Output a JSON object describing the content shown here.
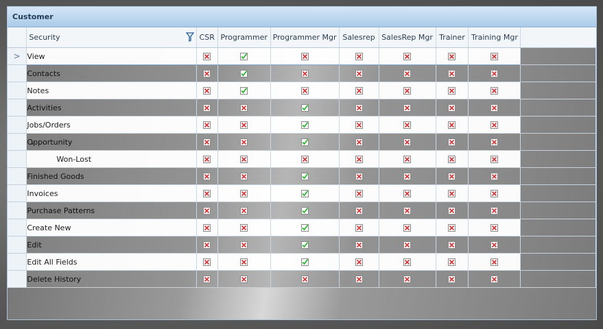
{
  "title": "Customer",
  "columns": [
    "Security",
    "CSR",
    "Programmer",
    "Programmer Mgr",
    "Salesrep",
    "SalesRep Mgr",
    "Trainer",
    "Training Mgr"
  ],
  "rows": [
    {
      "label": "View",
      "perms": [
        0,
        1,
        0,
        0,
        0,
        0,
        0
      ]
    },
    {
      "label": "Contacts",
      "perms": [
        0,
        1,
        0,
        0,
        0,
        0,
        0
      ]
    },
    {
      "label": "Notes",
      "perms": [
        0,
        1,
        0,
        0,
        0,
        0,
        0
      ]
    },
    {
      "label": "Activities",
      "perms": [
        0,
        0,
        1,
        0,
        0,
        0,
        0
      ]
    },
    {
      "label": "Jobs/Orders",
      "perms": [
        0,
        0,
        1,
        0,
        0,
        0,
        0
      ]
    },
    {
      "label": "Opportunity",
      "perms": [
        0,
        0,
        1,
        0,
        0,
        0,
        0
      ]
    },
    {
      "label": "Won-Lost",
      "perms": [
        0,
        0,
        0,
        0,
        0,
        0,
        0
      ]
    },
    {
      "label": "Finished Goods",
      "perms": [
        0,
        0,
        1,
        0,
        0,
        0,
        0
      ]
    },
    {
      "label": "Invoices",
      "perms": [
        0,
        0,
        1,
        0,
        0,
        0,
        0
      ]
    },
    {
      "label": "Purchase Patterns",
      "perms": [
        0,
        0,
        1,
        0,
        0,
        0,
        0
      ]
    },
    {
      "label": "Create New",
      "perms": [
        0,
        0,
        1,
        0,
        0,
        0,
        0
      ]
    },
    {
      "label": "Edit",
      "perms": [
        0,
        0,
        1,
        0,
        0,
        0,
        0
      ]
    },
    {
      "label": "Edit All Fields",
      "perms": [
        0,
        0,
        1,
        0,
        0,
        0,
        0
      ]
    },
    {
      "label": "Delete History",
      "perms": [
        0,
        0,
        0,
        0,
        0,
        0,
        0
      ]
    }
  ],
  "current_row_indicator": ">",
  "colors": {
    "check": "#2bb52b",
    "deny": "#d63a3a",
    "header_accent": "#aacbe8"
  }
}
